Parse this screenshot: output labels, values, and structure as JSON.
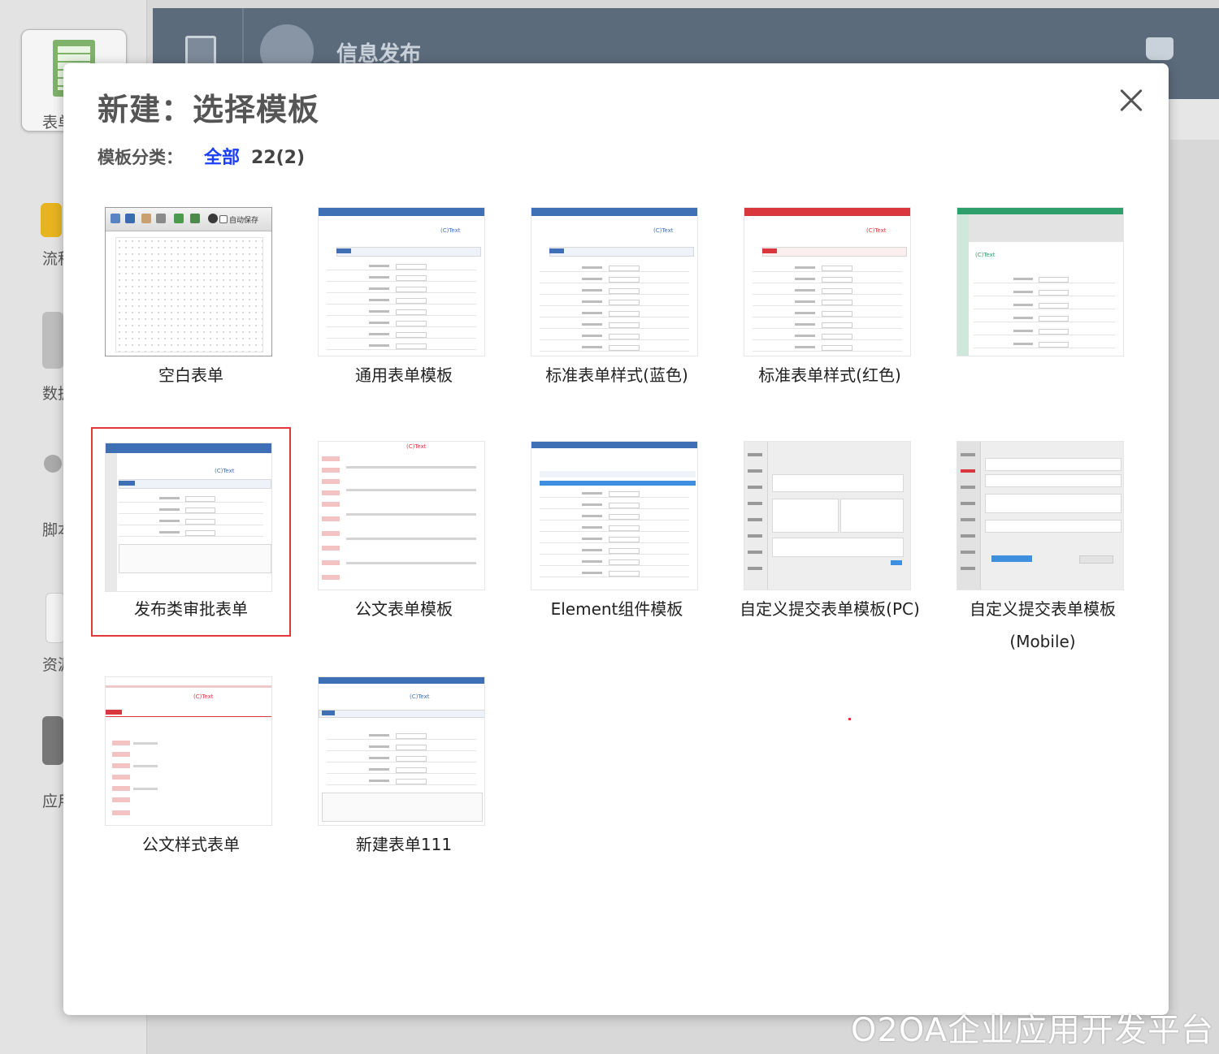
{
  "background": {
    "sidebar_labels": [
      "表单",
      "流程",
      "数据",
      "脚本",
      "资源",
      "应用"
    ],
    "header_title": "信息发布",
    "watermark": "O2OA企业应用开发平台"
  },
  "modal": {
    "title": "新建：选择模板",
    "category_label": "模板分类：",
    "category_all": "全部",
    "category_count": "22(2)"
  },
  "templates": [
    {
      "label": "空白表单"
    },
    {
      "label": "通用表单模板"
    },
    {
      "label": "标准表单样式(蓝色)"
    },
    {
      "label": "标准表单样式(红色)"
    },
    {
      "label": ""
    },
    {
      "label": "发布类审批表单"
    },
    {
      "label": "公文表单模板"
    },
    {
      "label": "Element组件模板"
    },
    {
      "label": "自定义提交表单模板(PC)"
    },
    {
      "label": "自定义提交表单模板",
      "label2": "(Mobile)"
    },
    {
      "label": "公文样式表单"
    },
    {
      "label": "新建表单111"
    }
  ],
  "thumbnail_text": {
    "c_text": "(C)Text",
    "autosave": "自动保存"
  },
  "colors": {
    "blue": "#3f6fb4",
    "red": "#d9363e",
    "green": "#2e9e6b",
    "selection": "#e2373a",
    "link": "#1a3fff"
  }
}
